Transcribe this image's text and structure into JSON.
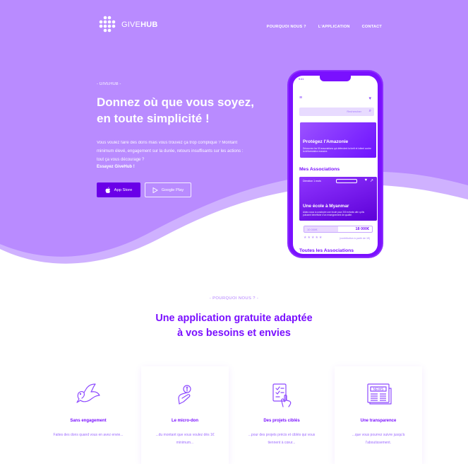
{
  "brand": {
    "name_light": "GIVE",
    "name_bold": "HUB"
  },
  "nav": {
    "links": [
      "POURQUOI NOUS ?",
      "L'APPLICATION",
      "CONTACT"
    ]
  },
  "hero": {
    "kicker": "- GIVEHUB -",
    "title": "Donnez où que vous soyez, en toute simplicité !",
    "description": "Vous voulez faire des dons mais vous trouvez ça trop compliqué ? Montant minimum élevé, engagement sur la durée, retours insuffisants sur les actions : tout ça vous décourage ?",
    "cta": "Essayez GiveHub !",
    "buttons": {
      "app_store": "App Store",
      "google_play": "Google Play"
    }
  },
  "phone": {
    "status_time": "9:41",
    "search_placeholder": "Rechercher",
    "card1": {
      "title": "Protégez l'Amazonie",
      "text": "Découvrez les 50 associations qui défendent la forêt et luttent contre la déforestation massive."
    },
    "section_title": "Mes Associations",
    "card2": {
      "top": "Direction 1 mois",
      "title": "Une école à Myanmar",
      "text": "Aidez-nous à construire une école pour 200 enfants afin qu'ils puissent bénéficier d'un enseignement de qualité."
    },
    "progress": {
      "label": "10 000€",
      "amount": "18 000€",
      "fraction": 0.5
    },
    "rating_note": "(contribution à partir de 1€)",
    "section_title_2": "Toutes les Associations"
  },
  "about": {
    "kicker": "- POURQUOI NOUS ? -",
    "title_line1": "Une application gratuite adaptée",
    "title_line2": "à vos besoins et envies"
  },
  "features": [
    {
      "icon": "dove-icon",
      "title": "Sans engagement",
      "text": "Faites des dons quand vous en avez envie..."
    },
    {
      "icon": "coin-hand-icon",
      "title": "Le micro-don",
      "text": "...du montant que vous voulez dès 1€ minimum..."
    },
    {
      "icon": "checklist-icon",
      "title": "Des projets ciblés",
      "text": "...pour des projets précis et ciblés qui vous tiennent à cœur..."
    },
    {
      "icon": "newspaper-icon",
      "title": "Une transparence",
      "text": "...que vous pourrez suivre jusqu'à l'aboutissement."
    }
  ],
  "colors": {
    "hero_bg": "#b98bff",
    "primary": "#7a10ff",
    "button_dark": "#6a00e8"
  }
}
